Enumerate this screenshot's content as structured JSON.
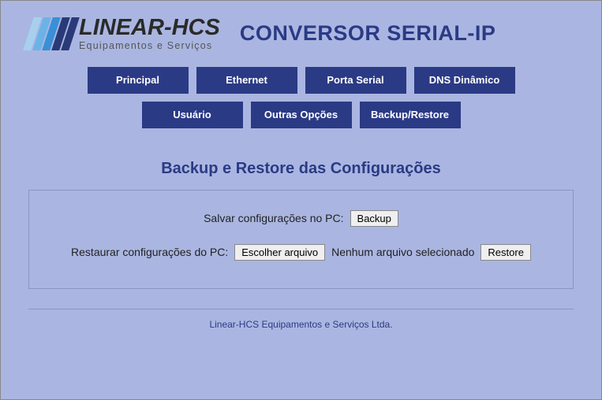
{
  "logo": {
    "main": "LINEAR-HCS",
    "sub": "Equipamentos e Serviços"
  },
  "title": "CONVERSOR SERIAL-IP",
  "nav": {
    "row1": [
      "Principal",
      "Ethernet",
      "Porta Serial",
      "DNS Dinâmico"
    ],
    "row2": [
      "Usuário",
      "Outras Opções",
      "Backup/Restore"
    ]
  },
  "section_title": "Backup e Restore das Configurações",
  "backup": {
    "label": "Salvar configurações no PC:",
    "button": "Backup"
  },
  "restore": {
    "label": "Restaurar configurações do PC:",
    "choose": "Escolher arquivo",
    "status": "Nenhum arquivo selecionado",
    "button": "Restore"
  },
  "footer": "Linear-HCS Equipamentos e Serviços Ltda."
}
